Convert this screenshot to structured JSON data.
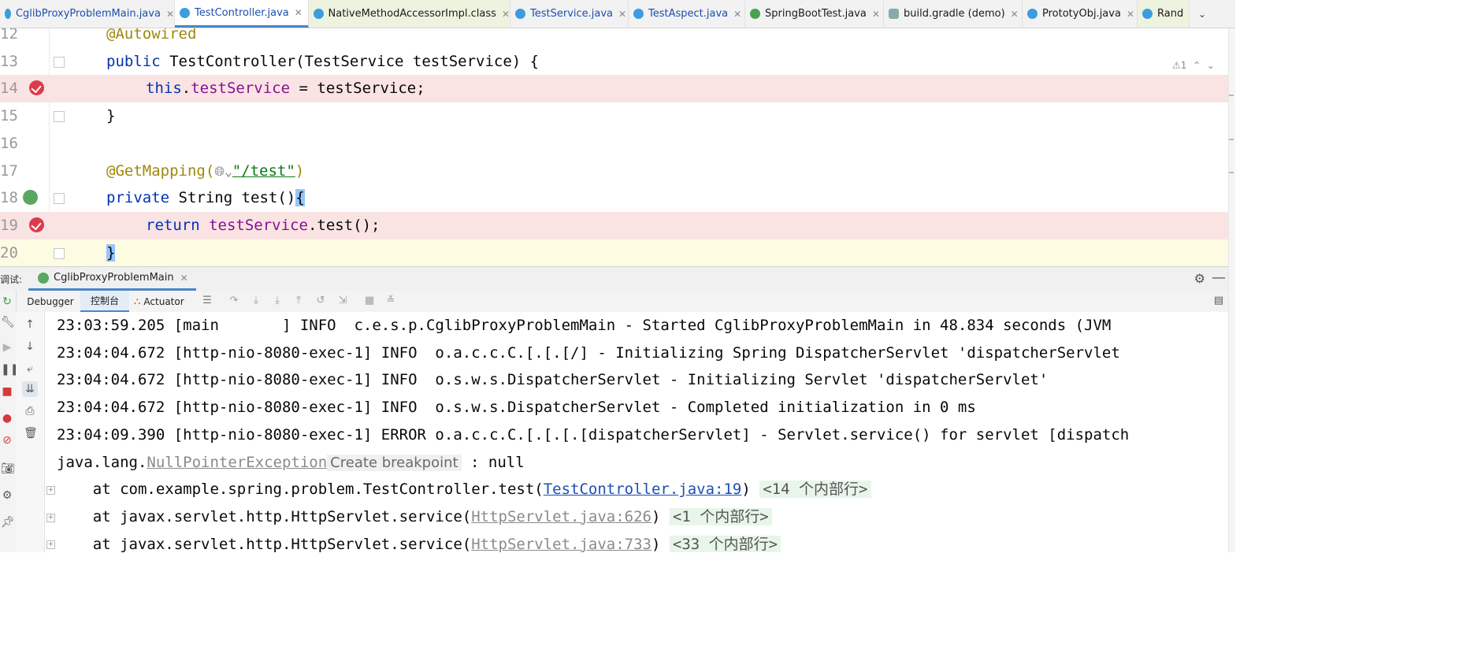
{
  "tabs": [
    {
      "label": "CglibProxyProblemMain.java",
      "icon": "java-class-icon",
      "active": false
    },
    {
      "label": "TestController.java",
      "icon": "java-class-icon",
      "active": true
    },
    {
      "label": "NativeMethodAccessorImpl.class",
      "icon": "class-file-icon",
      "active": false
    },
    {
      "label": "TestService.java",
      "icon": "java-class-icon",
      "active": false
    },
    {
      "label": "TestAspect.java",
      "icon": "java-class-icon",
      "active": false
    },
    {
      "label": "SpringBootTest.java",
      "icon": "spring-boot-icon",
      "active": false
    },
    {
      "label": "build.gradle (demo)",
      "icon": "gradle-icon",
      "active": false
    },
    {
      "label": "PrototyObj.java",
      "icon": "java-class-icon",
      "active": false
    },
    {
      "label": "Rand",
      "icon": "java-class-icon",
      "active": false
    }
  ],
  "editor": {
    "warning_count": "1",
    "lines": [
      {
        "num": "12"
      },
      {
        "num": "13"
      },
      {
        "num": "14"
      },
      {
        "num": "15"
      },
      {
        "num": "16"
      },
      {
        "num": "17"
      },
      {
        "num": "18"
      },
      {
        "num": "19"
      },
      {
        "num": "20"
      }
    ],
    "code": {
      "l12_ann": "@Autowired",
      "l13_kw": "public",
      "l13_rest": " TestController(TestService testService) {",
      "l14_kw": "this",
      "l14_dot": ".",
      "l14_field": "testService",
      "l14_rest": " = testService;",
      "l15": "}",
      "l17_ann": "@GetMapping(",
      "l17_str": "\"/test\"",
      "l17_close": ")",
      "l18_kw": "private",
      "l18_rest": " String test()",
      "l18_brace": "{",
      "l19_kw": "return",
      "l19_field": "testService",
      "l19_rest": ".test();",
      "l20_brace": "}"
    }
  },
  "debug": {
    "label": "调试:",
    "session_tab": "CglibProxyProblemMain",
    "tabs": {
      "debugger": "Debugger",
      "console": "控制台",
      "actuator": "Actuator"
    }
  },
  "console": {
    "l1": "23:03:59.205 [main       ] INFO  c.e.s.p.CglibProxyProblemMain - Started CglibProxyProblemMain in 48.834 seconds (JVM ",
    "l2": "23:04:04.672 [http-nio-8080-exec-1] INFO  o.a.c.c.C.[.[.[/] - Initializing Spring DispatcherServlet 'dispatcherServlet",
    "l3": "23:04:04.672 [http-nio-8080-exec-1] INFO  o.s.w.s.DispatcherServlet - Initializing Servlet 'dispatcherServlet'",
    "l4": "23:04:04.672 [http-nio-8080-exec-1] INFO  o.s.w.s.DispatcherServlet - Completed initialization in 0 ms",
    "l5": "23:04:09.390 [http-nio-8080-exec-1] ERROR o.a.c.c.C.[.[.[.[dispatcherServlet] - Servlet.service() for servlet [dispatch",
    "l6_pre": "java.lang.",
    "l6_exc": "NullPointerException",
    "l6_hint": "Create breakpoint",
    "l6_post": " : null",
    "frames": [
      {
        "at": "    at com.example.spring.problem.TestController.test(",
        "link": "TestController.java:19",
        "close": ")",
        "folded": "<14 个内部行>"
      },
      {
        "at": "    at javax.servlet.http.HttpServlet.service(",
        "link": "HttpServlet.java:626",
        "close": ")",
        "folded": "<1 个内部行>"
      },
      {
        "at": "    at javax.servlet.http.HttpServlet.service(",
        "link": "HttpServlet.java:733",
        "close": ")",
        "folded": "<33 个内部行>"
      }
    ]
  }
}
